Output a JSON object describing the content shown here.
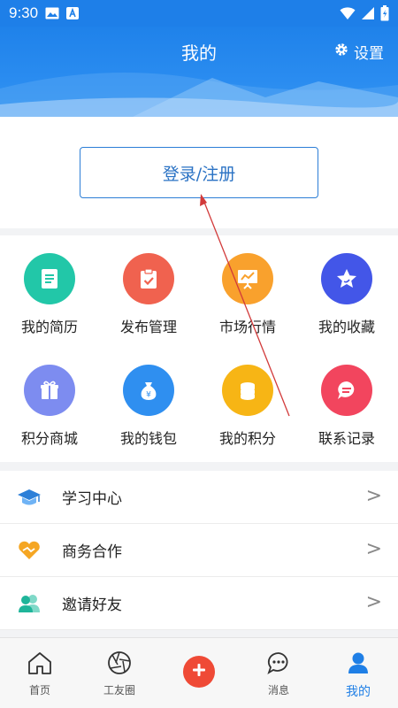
{
  "status_bar": {
    "time": "9:30"
  },
  "header": {
    "title": "我的",
    "settings_label": "设置"
  },
  "login": {
    "label": "登录/注册"
  },
  "grid": {
    "items": [
      {
        "label": "我的简历",
        "icon": "resume-icon",
        "color": "#22c7a8"
      },
      {
        "label": "发布管理",
        "icon": "clipboard-icon",
        "color": "#f0624f"
      },
      {
        "label": "市场行情",
        "icon": "chart-board-icon",
        "color": "#f9a12d"
      },
      {
        "label": "我的收藏",
        "icon": "star-icon",
        "color": "#4356e8"
      },
      {
        "label": "积分商城",
        "icon": "gift-icon",
        "color": "#7d8cf0"
      },
      {
        "label": "我的钱包",
        "icon": "money-bag-icon",
        "color": "#2f8ff0"
      },
      {
        "label": "我的积分",
        "icon": "coins-icon",
        "color": "#f7b515"
      },
      {
        "label": "联系记录",
        "icon": "chat-icon",
        "color": "#f2455e"
      }
    ]
  },
  "list": {
    "items": [
      {
        "label": "学习中心",
        "icon": "graduation-cap-icon"
      },
      {
        "label": "商务合作",
        "icon": "handshake-icon"
      },
      {
        "label": "邀请好友",
        "icon": "users-icon"
      }
    ],
    "chevron": ">"
  },
  "bottom_nav": {
    "items": [
      {
        "label": "首页",
        "icon": "home-icon"
      },
      {
        "label": "工友圈",
        "icon": "aperture-icon"
      },
      {
        "label": "",
        "icon": "plus-icon"
      },
      {
        "label": "消息",
        "icon": "message-icon"
      },
      {
        "label": "我的",
        "icon": "user-icon",
        "active": true
      }
    ]
  },
  "colors": {
    "primary": "#1f7fe6",
    "plus": "#ef4a36",
    "annotation_arrow": "#d23a3a"
  }
}
